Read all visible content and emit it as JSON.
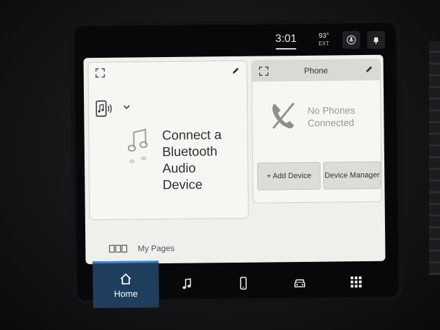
{
  "status_bar": {
    "time": "3:01",
    "temperature": "93°",
    "temperature_label": "EXT"
  },
  "media_card": {
    "message_lines": [
      "Connect a",
      "Bluetooth",
      "Audio",
      "Device"
    ]
  },
  "phone_card": {
    "title": "Phone",
    "status_lines": [
      "No Phones",
      "Connected"
    ],
    "add_device_label": "+ Add Device",
    "device_manager_label": "Device Manager"
  },
  "footer": {
    "my_pages_label": "My Pages"
  },
  "nav": {
    "home_label": "Home"
  },
  "colors": {
    "nav_active_bg": "#1f3d5c",
    "nav_active_accent": "#3f86c9",
    "panel_bg": "#efefec"
  },
  "icons": [
    "expand-icon",
    "pencil-icon",
    "media-source-icon",
    "chevron-down-icon",
    "music-note-icon",
    "phone-disconnected-icon",
    "pages-icon",
    "home-icon",
    "music-icon",
    "phone-icon",
    "vehicle-icon",
    "apps-grid-icon",
    "voice-command-icon",
    "notification-bell-icon"
  ]
}
